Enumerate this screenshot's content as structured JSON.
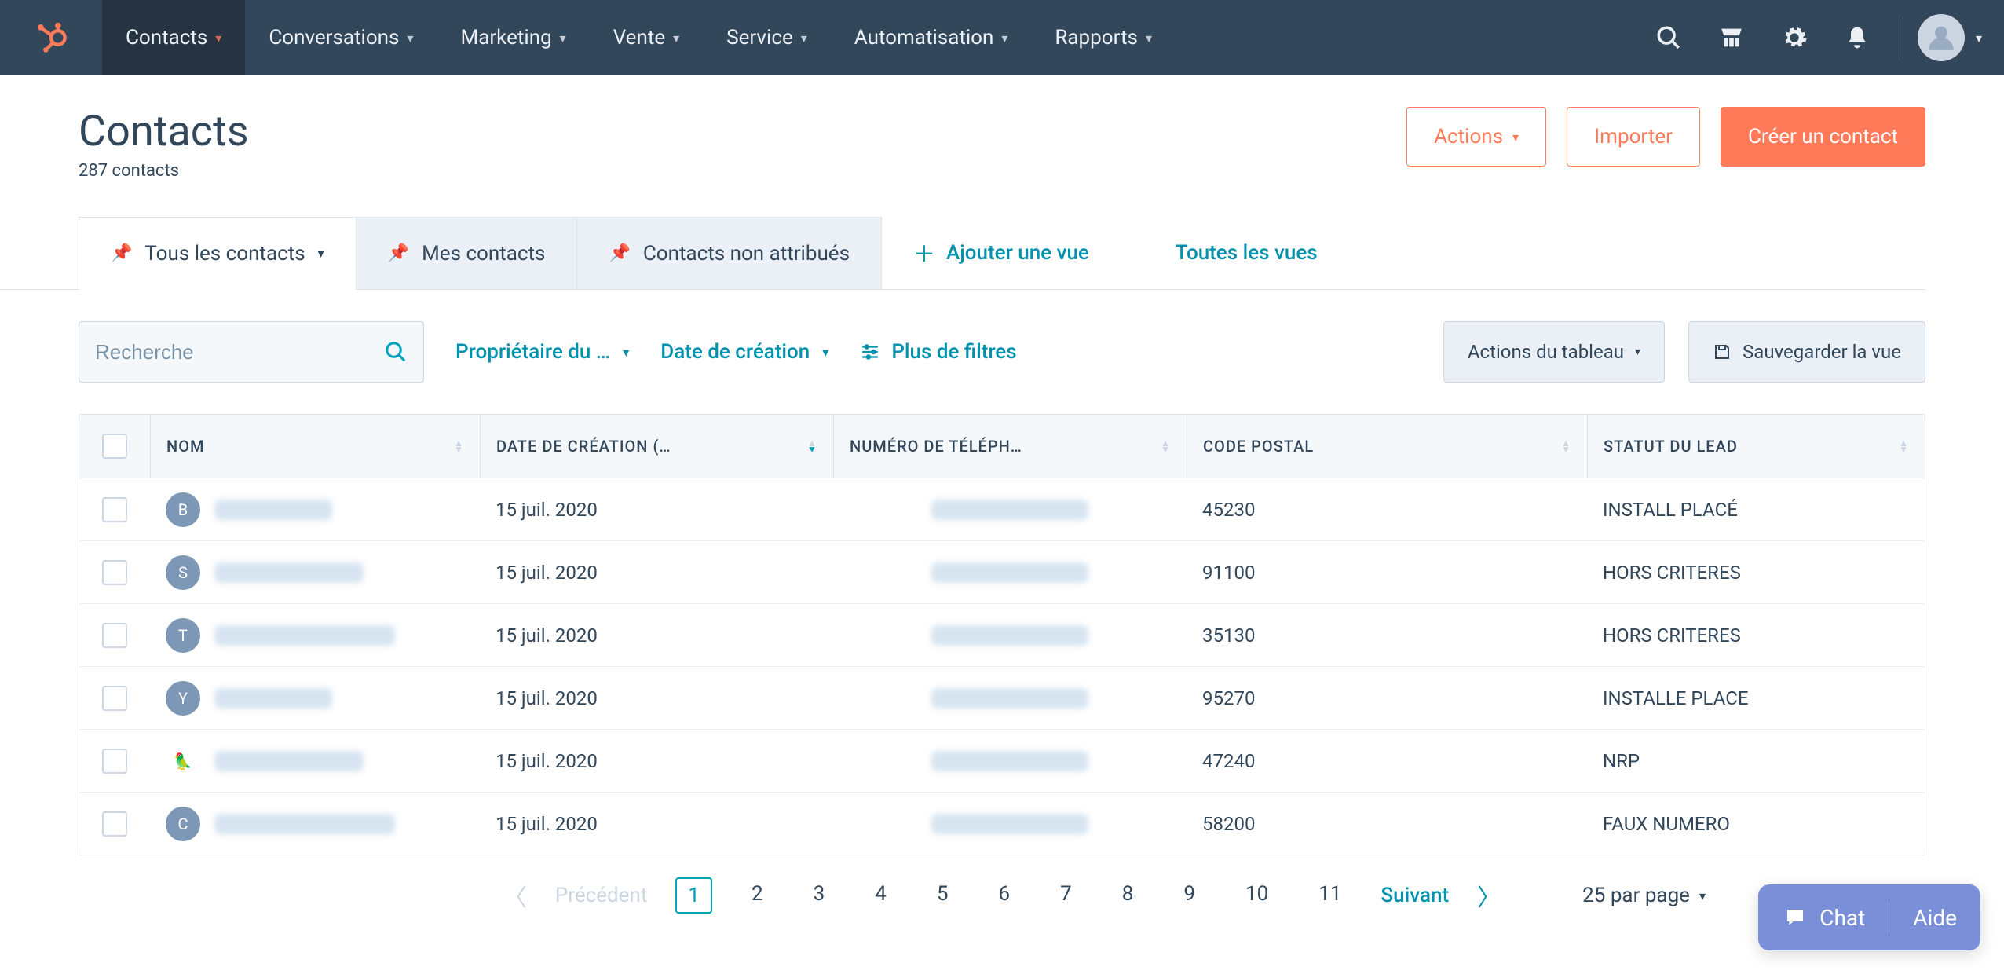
{
  "nav": {
    "items": [
      {
        "label": "Contacts",
        "active": true
      },
      {
        "label": "Conversations"
      },
      {
        "label": "Marketing"
      },
      {
        "label": "Vente"
      },
      {
        "label": "Service"
      },
      {
        "label": "Automatisation"
      },
      {
        "label": "Rapports"
      }
    ]
  },
  "header": {
    "title": "Contacts",
    "count_text": "287 contacts",
    "actions_label": "Actions",
    "import_label": "Importer",
    "create_label": "Créer un contact"
  },
  "views": {
    "tabs": [
      {
        "label": "Tous les contacts"
      },
      {
        "label": "Mes contacts"
      },
      {
        "label": "Contacts non attribués"
      }
    ],
    "add_view": "Ajouter une vue",
    "all_views": "Toutes les vues"
  },
  "filters": {
    "search_placeholder": "Recherche",
    "owner": "Propriétaire du …",
    "create_date": "Date de création",
    "more": "Plus de filtres",
    "table_actions": "Actions du tableau",
    "save_view": "Sauvegarder la vue"
  },
  "table": {
    "columns": {
      "name": "NOM",
      "created": "DATE DE CRÉATION (…",
      "phone": "NUMÉRO DE TÉLÉPH…",
      "postal": "CODE POSTAL",
      "lead_status": "STATUT DU LEAD"
    },
    "rows": [
      {
        "initial": "B",
        "created": "15 juil. 2020",
        "postal": "45230",
        "status": "INSTALL PLACÉ"
      },
      {
        "initial": "S",
        "created": "15 juil. 2020",
        "postal": "91100",
        "status": "HORS CRITERES"
      },
      {
        "initial": "T",
        "created": "15 juil. 2020",
        "postal": "35130",
        "status": "HORS CRITERES"
      },
      {
        "initial": "Y",
        "created": "15 juil. 2020",
        "postal": "95270",
        "status": "INSTALLE PLACE"
      },
      {
        "initial": "",
        "created": "15 juil. 2020",
        "postal": "47240",
        "status": "NRP"
      },
      {
        "initial": "C",
        "created": "15 juil. 2020",
        "postal": "58200",
        "status": "FAUX NUMERO"
      }
    ]
  },
  "pagination": {
    "prev": "Précédent",
    "pages": [
      "1",
      "2",
      "3",
      "4",
      "5",
      "6",
      "7",
      "8",
      "9",
      "10",
      "11"
    ],
    "next": "Suivant",
    "per_page": "25 par page"
  },
  "chat": {
    "chat": "Chat",
    "help": "Aide"
  }
}
